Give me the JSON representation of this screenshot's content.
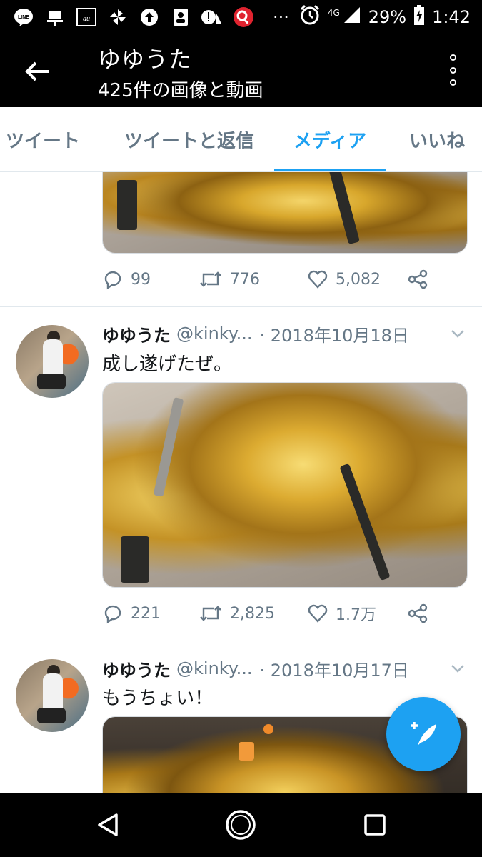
{
  "status_bar": {
    "icons": [
      "line-icon",
      "notification-icon",
      "au-icon",
      "pinwheel-icon",
      "upload-icon",
      "contacts-icon",
      "alert-icon",
      "search-app-icon"
    ],
    "more": "···",
    "network": "4G",
    "battery": "29%",
    "time": "1:42"
  },
  "app_bar": {
    "title": "ゆゆうた",
    "subtitle": "425件の画像と動画"
  },
  "tabs": [
    {
      "label": "ツイート",
      "active": false
    },
    {
      "label": "ツイートと返信",
      "active": false
    },
    {
      "label": "メディア",
      "active": true
    },
    {
      "label": "いいね",
      "active": false
    }
  ],
  "tweets": [
    {
      "partial": true,
      "replies": "99",
      "retweets": "776",
      "likes": "5,082"
    },
    {
      "name": "ゆゆうた",
      "handle": "@kinky...",
      "date": "· 2018年10月18日",
      "text": "成し遂げたぜ。",
      "replies": "221",
      "retweets": "2,825",
      "likes": "1.7万"
    },
    {
      "name": "ゆゆうた",
      "handle": "@kinky...",
      "date": "· 2018年10月17日",
      "text": "もうちょい！"
    }
  ],
  "colors": {
    "accent": "#1da1f2",
    "text_secondary": "#657786",
    "bar": "#000000"
  },
  "fab": {
    "icon": "compose-tweet-icon"
  }
}
